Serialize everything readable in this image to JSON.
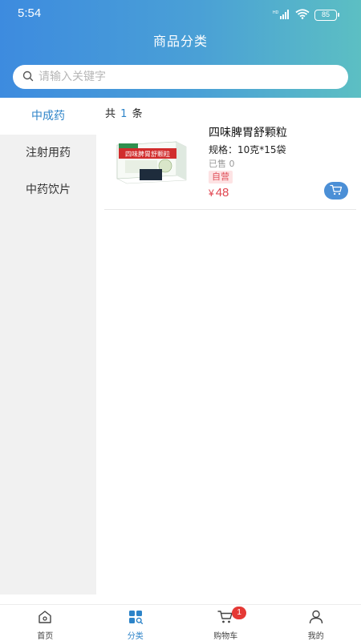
{
  "status_bar": {
    "time": "5:54",
    "battery": "85",
    "network": "HD"
  },
  "header": {
    "title": "商品分类"
  },
  "search": {
    "placeholder": "请输入关键字"
  },
  "sidebar": {
    "items": [
      {
        "label": "中成药",
        "active": true
      },
      {
        "label": "注射用药",
        "active": false
      },
      {
        "label": "中药饮片",
        "active": false
      }
    ]
  },
  "content": {
    "count_prefix": "共",
    "count": "1",
    "count_suffix": "条",
    "products": [
      {
        "name": "四味脾胃舒颗粒",
        "spec": "规格：10克*15袋",
        "sold": "已售 0",
        "tag": "自营",
        "currency": "¥",
        "price": "48",
        "box_text": "四味脾胃舒颗粒"
      }
    ]
  },
  "tabbar": {
    "tabs": [
      {
        "label": "首页",
        "icon": "home-icon"
      },
      {
        "label": "分类",
        "icon": "category-icon",
        "active": true
      },
      {
        "label": "购物车",
        "icon": "cart-icon",
        "badge": "1"
      },
      {
        "label": "我的",
        "icon": "user-icon"
      }
    ]
  },
  "colors": {
    "accent": "#2c83c8",
    "price": "#e0454f",
    "header_start": "#3d8bdf",
    "header_end": "#5cbfc3"
  }
}
